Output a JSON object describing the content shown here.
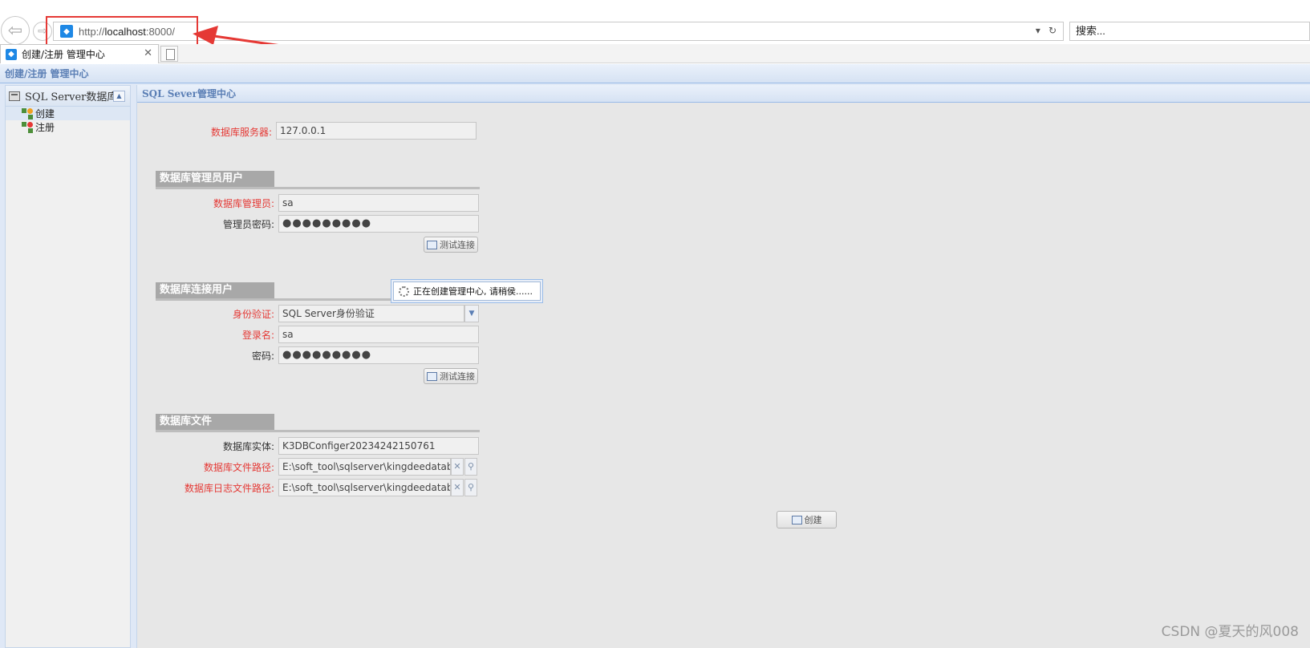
{
  "browser": {
    "url": "http://localhost:8000/",
    "url_host": "localhost",
    "url_scheme": "http://",
    "url_port": ":8000/",
    "search_placeholder": "搜索...",
    "tab_title": "创建/注册 管理中心"
  },
  "app": {
    "header_title": "创建/注册 管理中心",
    "sidebar": {
      "title": "SQL Server数据库",
      "items": [
        {
          "label": "创建",
          "icon": "create-icon"
        },
        {
          "label": "注册",
          "icon": "register-icon"
        }
      ]
    },
    "main": {
      "panel_title": "SQL Sever管理中心",
      "server_label": "数据库服务器:",
      "server_value": "127.0.0.1",
      "admin_section": "数据库管理员用户",
      "admin_label": "数据库管理员:",
      "admin_value": "sa",
      "admin_pw_label": "管理员密码:",
      "admin_pw_value": "●●●●●●●●●",
      "test_conn_label": "测试连接",
      "conn_section": "数据库连接用户",
      "auth_label": "身份验证:",
      "auth_value": "SQL Server身份验证",
      "login_label": "登录名:",
      "login_value": "sa",
      "pw_label": "密码:",
      "pw_value": "●●●●●●●●●",
      "test_conn_label2": "测试连接",
      "file_section": "数据库文件",
      "entity_label": "数据库实体:",
      "entity_value": "K3DBConfiger20234242150761",
      "file_path_label": "数据库文件路径:",
      "file_path_value": "E:\\soft_tool\\sqlserver\\kingdeedatabase",
      "log_path_label": "数据库日志文件路径:",
      "log_path_value": "E:\\soft_tool\\sqlserver\\kingdeedatabase",
      "create_button": "创建",
      "loading_text": "正在创建管理中心, 请稍侯......"
    }
  },
  "watermark": "CSDN @夏天的风008",
  "colors": {
    "required_label": "#e53935",
    "annotation": "#e53935",
    "header_text": "#5b7fb5"
  }
}
